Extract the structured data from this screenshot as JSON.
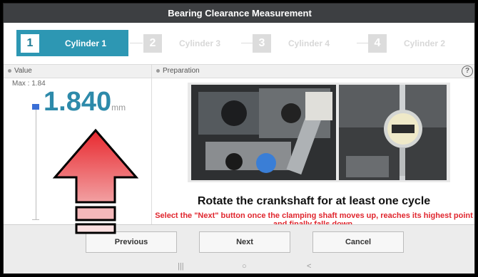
{
  "window": {
    "title": "Bearing Clearance Measurement"
  },
  "steps": [
    {
      "num": "1",
      "label": "Cylinder 1",
      "active": true
    },
    {
      "num": "2",
      "label": "Cylinder 3",
      "active": false
    },
    {
      "num": "3",
      "label": "Cylinder 4",
      "active": false
    },
    {
      "num": "4",
      "label": "Cylinder 2",
      "active": false
    }
  ],
  "value_panel": {
    "header": "Value",
    "max_text": "Max : 1.84",
    "reading": "1.840",
    "unit": "mm"
  },
  "prep_panel": {
    "header": "Preparation",
    "help_label": "?",
    "instruction": "Rotate the crankshaft for at least one cycle",
    "note": "Select the \"Next\" button once the clamping shaft moves up, reaches its highest point and finally falls down."
  },
  "buttons": {
    "previous": "Previous",
    "next": "Next",
    "cancel": "Cancel"
  },
  "nav": {
    "recents": "|||",
    "home": "○",
    "back": "<"
  },
  "colors": {
    "accent": "#2d97b3",
    "warning_arrow": "#e8282e",
    "note_red": "#e0262e",
    "titlebar": "#3d3f42"
  }
}
